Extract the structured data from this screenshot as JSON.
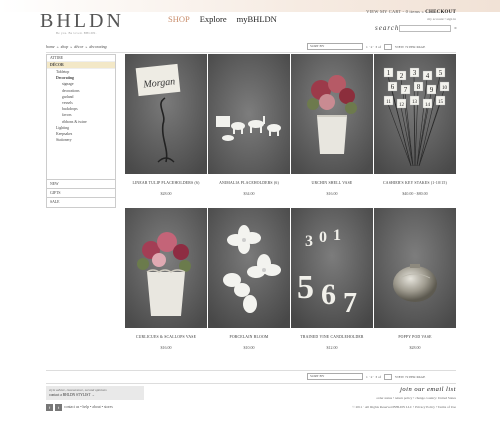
{
  "brand": {
    "logo": "BHLDN",
    "tagline": "Be you. Be loved. BHLDN."
  },
  "nav": {
    "items": [
      {
        "label": "SHOP",
        "active": true
      },
      {
        "label": "Explore",
        "active": false
      },
      {
        "label": "myBHLDN",
        "active": false
      }
    ]
  },
  "header": {
    "cart_label": "VIEW MY CART",
    "cart_items": "- 0 items",
    "checkout_label": "CHECKOUT",
    "account_links": "my account  •  sign in",
    "search_label": "search",
    "search_placeholder": "",
    "search_go": "»"
  },
  "breadcrumb": {
    "items": [
      "home",
      "shop",
      "décor",
      "decorating"
    ]
  },
  "sort": {
    "select_label": "SORT BY",
    "pages": "1 · 2 · 3 of",
    "view_label": "VIEW 72 PER PAGE"
  },
  "sidebar": {
    "categories": [
      {
        "label": "ATTIRE",
        "level": 0
      },
      {
        "label": "DÉCOR",
        "level": 0,
        "highlight": true
      },
      {
        "label": "Tabletop",
        "level": 1
      },
      {
        "label": "Decorating",
        "level": 1,
        "bold": true
      },
      {
        "label": "signage",
        "level": 2
      },
      {
        "label": "decorations",
        "level": 2
      },
      {
        "label": "garland",
        "level": 2
      },
      {
        "label": "vessels",
        "level": 2
      },
      {
        "label": "backdrops",
        "level": 2
      },
      {
        "label": "favors",
        "level": 2
      },
      {
        "label": "ribbons & twine",
        "level": 2
      },
      {
        "label": "Lighting",
        "level": 1
      },
      {
        "label": "Keepsakes",
        "level": 1
      },
      {
        "label": "Stationery",
        "level": 1
      }
    ],
    "bottom": [
      "NEW",
      "GIFTS",
      "SALE"
    ]
  },
  "products": [
    {
      "name": "LINEAR TULIP PLACEHOLDERS (6)",
      "price": "$28.00"
    },
    {
      "name": "ANIMALIA PLACEHOLDERS (6)",
      "price": "$34.00"
    },
    {
      "name": "URCHIN SHELL VASE",
      "price": "$16.00"
    },
    {
      "name": "CASHIER'S KEY STAKES (1-10/15)",
      "price": "$40.00 - $80.00"
    },
    {
      "name": "CURLICUES & SCALLOPS VASE",
      "price": "$16.00"
    },
    {
      "name": "PORCELAIN BLOOM",
      "price": "$10.00"
    },
    {
      "name": "TRAINED VINE CANDLEHOLDER",
      "price": "$12.00"
    },
    {
      "name": "POPPY POD VASE",
      "price": "$28.00"
    }
  ],
  "product_images": {
    "placecard_text": "Morgan",
    "stake_numbers": [
      "1",
      "2",
      "3",
      "4",
      "5",
      "6",
      "7",
      "8",
      "9",
      "10",
      "11",
      "12",
      "13",
      "14",
      "15"
    ],
    "candle_numbers": [
      "3",
      "0",
      "1",
      "5",
      "6",
      "7"
    ]
  },
  "footer": {
    "stylist_line1": "style advice, reassurance, second opinions",
    "stylist_line2": "contact a BHLDN STYLIST  →",
    "social": [
      "f",
      "t"
    ],
    "links": "contact us  •  help  •  about  •  stores",
    "join_label": "join  our  email  list",
    "legal_links": "order status  •  return policy  •  change country: United States",
    "copyright": "© 2011 · All Rights Reserved BHLDN LLC  •  Privacy Policy  •  Terms of Use"
  },
  "colors": {
    "accent": "#c88c6a",
    "highlight": "#f3e8c7",
    "photo_bg": "#5a5a5a"
  }
}
